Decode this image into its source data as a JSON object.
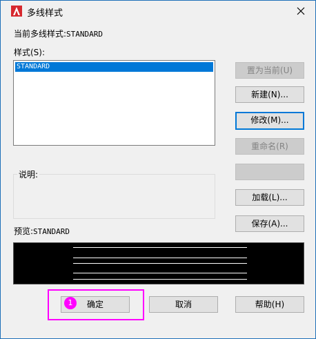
{
  "window": {
    "title": "多线样式"
  },
  "current_style": {
    "label": "当前多线样式:",
    "value": "STANDARD"
  },
  "styles": {
    "label": "样式(S):",
    "items": [
      "STANDARD"
    ],
    "selected": "STANDARD"
  },
  "buttons": {
    "set_current": "置为当前(U)",
    "new": "新建(N)...",
    "modify": "修改(M)...",
    "rename": "重命名(R)",
    "delete": "",
    "load": "加载(L)...",
    "save": "保存(A)...",
    "ok": "确定",
    "cancel": "取消",
    "help": "帮助(H)"
  },
  "description": {
    "label": "说明:",
    "value": ""
  },
  "preview": {
    "label": "预览:",
    "value": "STANDARD"
  },
  "annotation": {
    "badge": "1",
    "color": "#ff00ff"
  },
  "colors": {
    "selection": "#0078d7",
    "app_icon": "#d6282e"
  }
}
